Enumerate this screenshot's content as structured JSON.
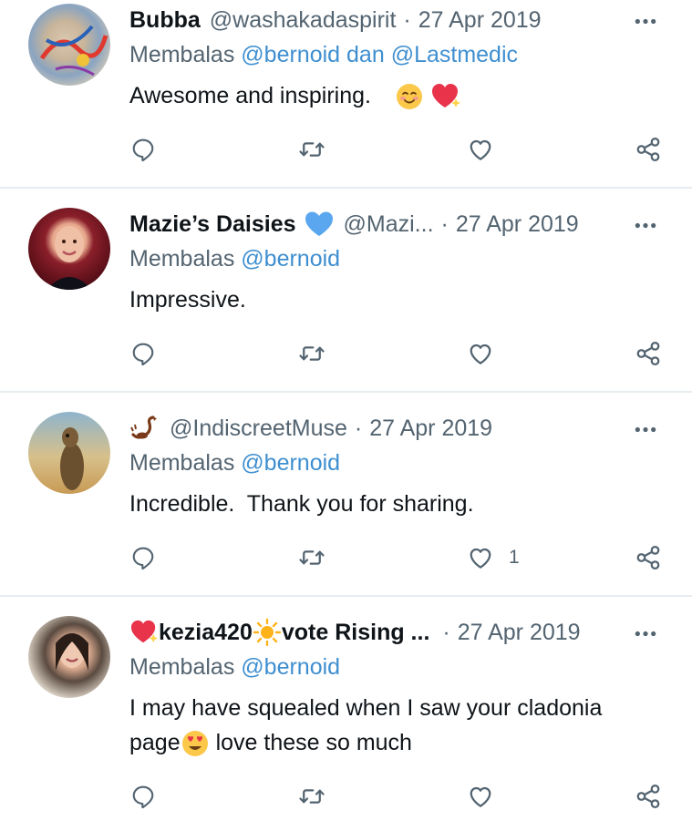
{
  "reply_to_label": "Membalas",
  "tweets": [
    {
      "name": "Bubba",
      "handle": "@washakadaspirit",
      "date": "27 Apr 2019",
      "mentions": [
        "@bernoid",
        "@Lastmedic"
      ],
      "mention_joiner": "dan",
      "text": "Awesome and inspiring.",
      "like_count": ""
    },
    {
      "name": "Mazie’s Daisies",
      "handle": "@Mazi...",
      "date": "27 Apr 2019",
      "mentions": [
        "@bernoid"
      ],
      "text": "Impressive.",
      "like_count": ""
    },
    {
      "name": "",
      "handle": "@IndiscreetMuse",
      "date": "27 Apr 2019",
      "mentions": [
        "@bernoid"
      ],
      "text": "Incredible.  Thank you for sharing.",
      "like_count": "1"
    },
    {
      "name_part1": "kezia420",
      "name_part2": "vote Rising ...",
      "date": "27 Apr 2019",
      "mentions": [
        "@bernoid"
      ],
      "text_line1": "I may have squealed when I saw your cladonia",
      "text_line2_a": "page",
      "text_line2_b": " love these so much",
      "like_count": ""
    }
  ],
  "icons": {
    "reply": "comment-bubble-icon",
    "retweet": "retweet-icon",
    "like": "heart-icon",
    "share": "share-icon",
    "more": "more-dots-icon"
  },
  "colors": {
    "text": "#0f1419",
    "secondary": "#536471",
    "mention": "#3f8fd0",
    "divider": "#e6ecf0",
    "verified_heart": "#5aa7f0"
  }
}
